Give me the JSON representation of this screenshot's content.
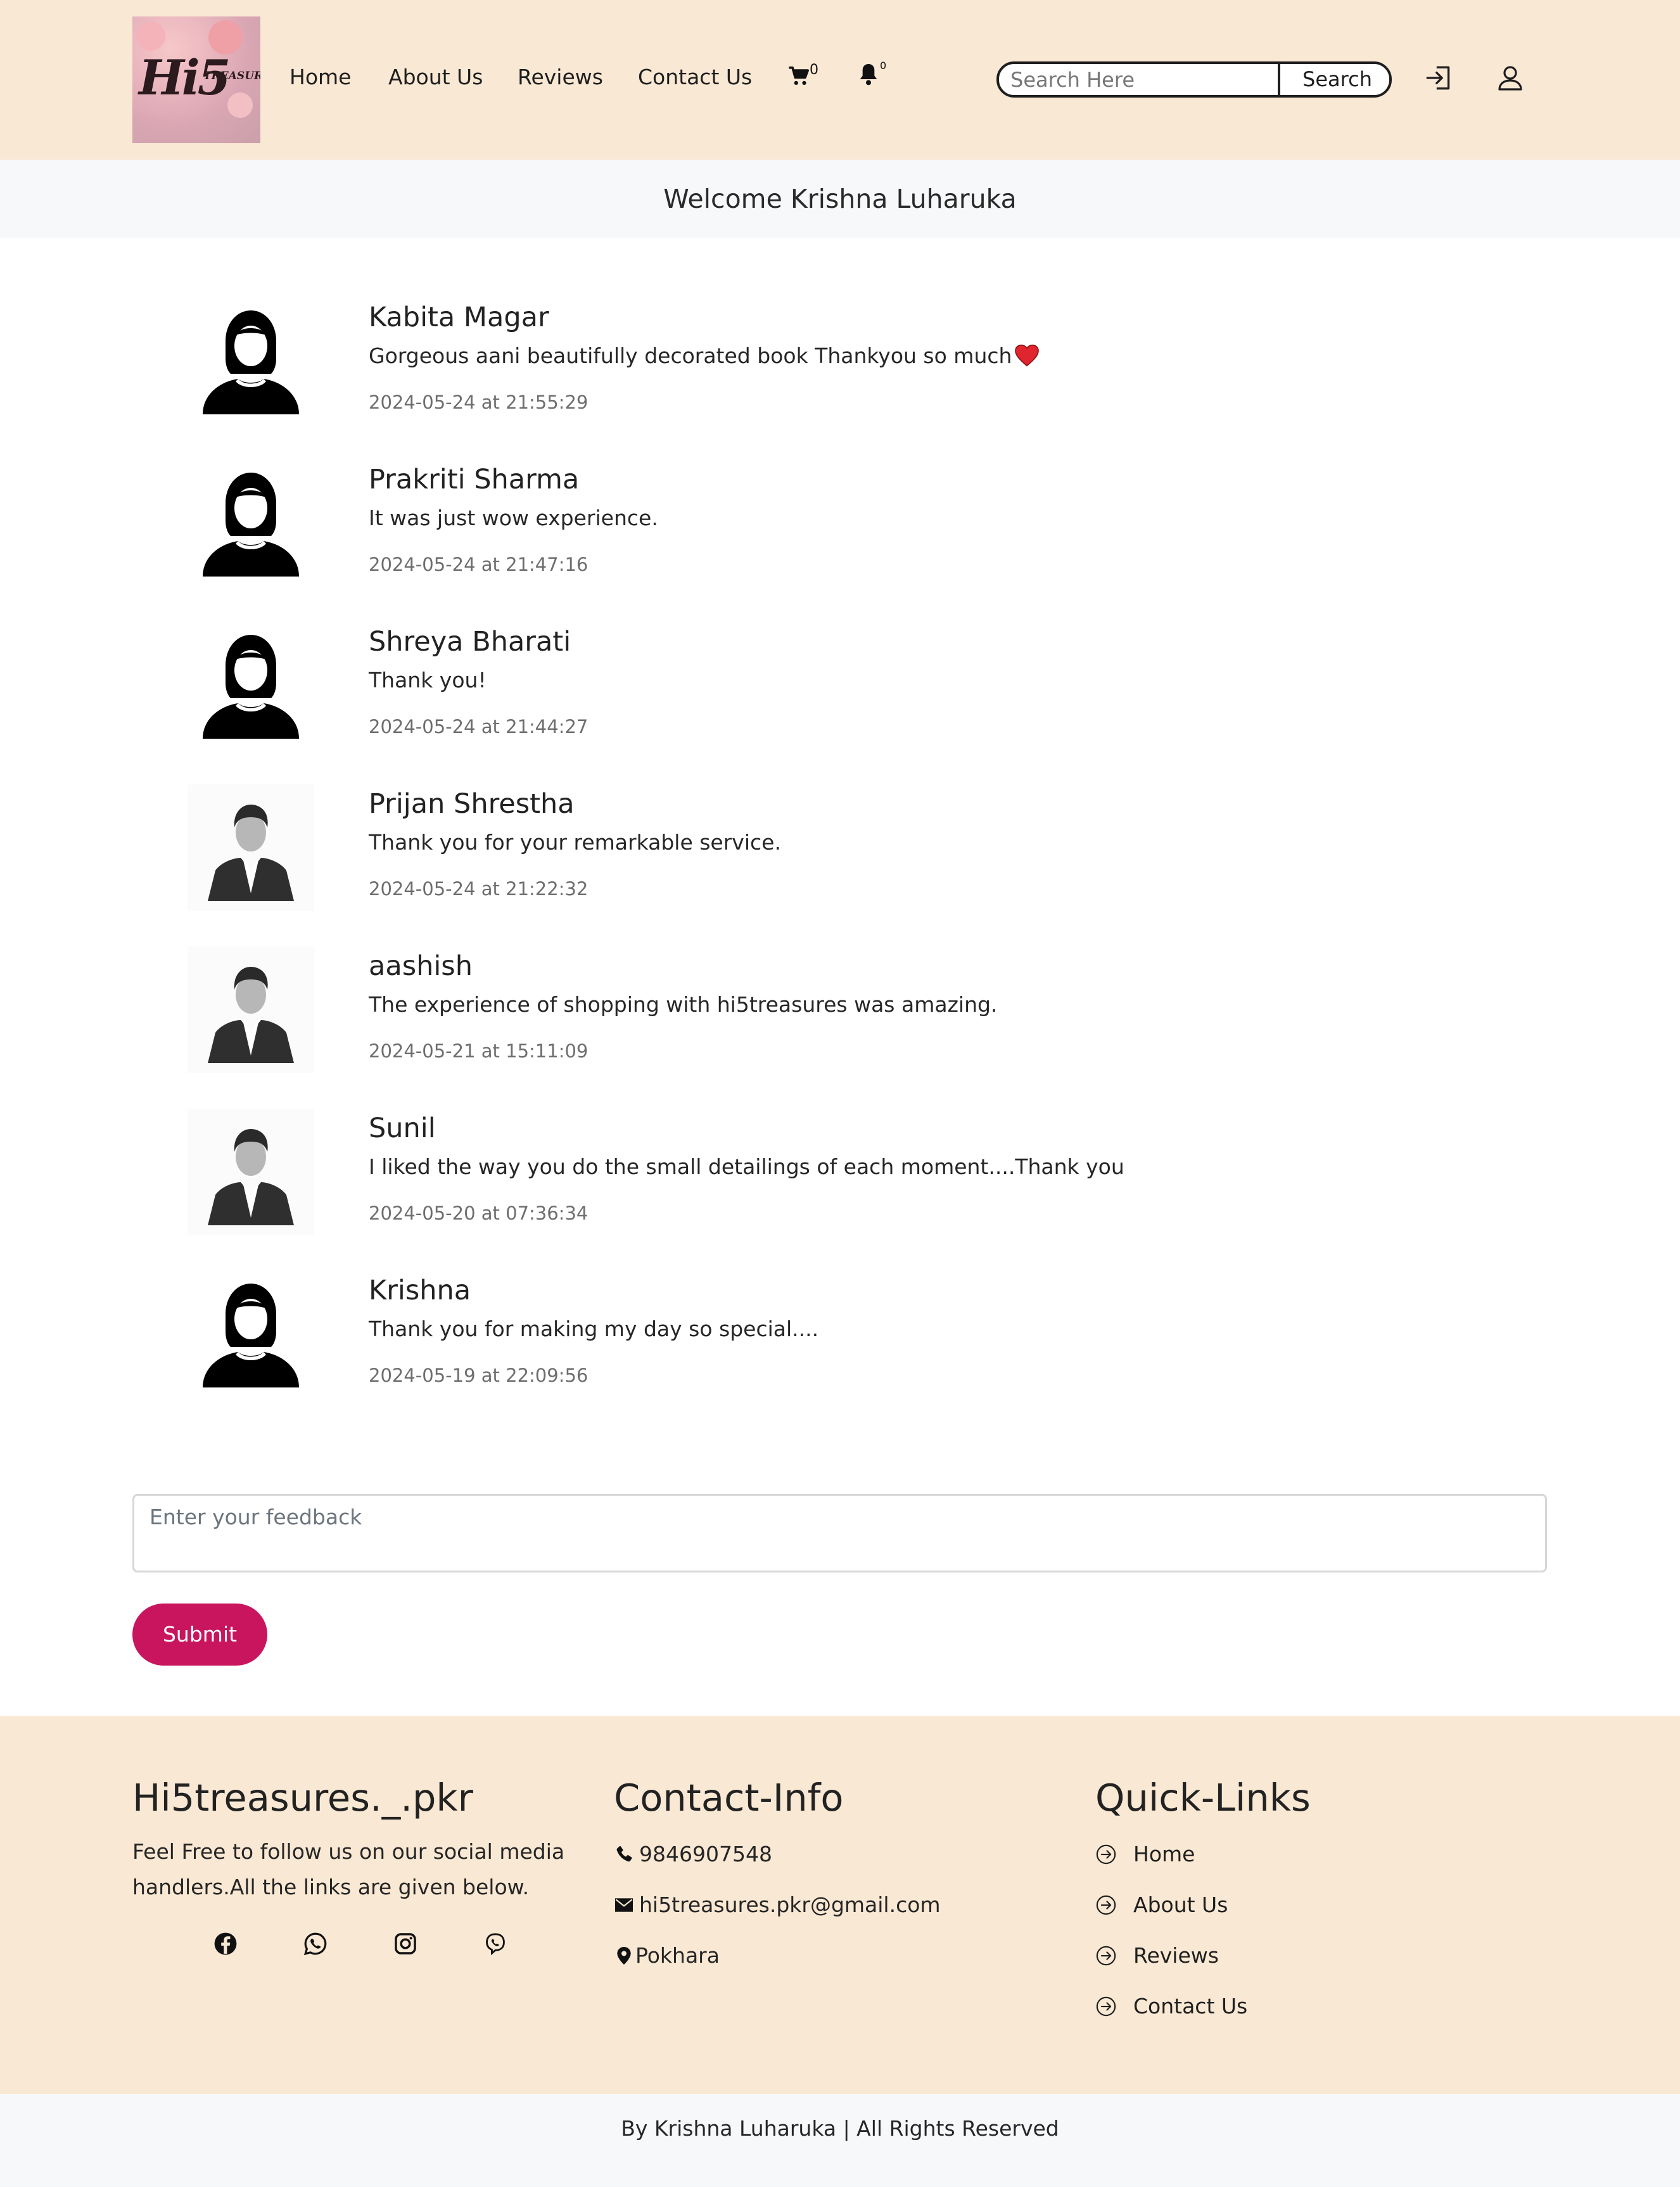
{
  "logo": {
    "main": "Hi5",
    "sub": "TREASURES"
  },
  "nav": {
    "links": [
      "Home",
      "About Us",
      "Reviews",
      "Contact Us"
    ],
    "cart_count": "0",
    "notif_count": "0",
    "search_placeholder": "Search Here",
    "search_button": "Search",
    "icons": [
      "cart-icon",
      "bell-icon",
      "login-icon",
      "user-icon"
    ]
  },
  "welcome": "Welcome Krishna Luharuka",
  "reviews": [
    {
      "name": "Kabita Magar",
      "text": "Gorgeous aani beautifully decorated book Thankyou so much",
      "date": "2024-05-24 at 21:55:29",
      "avatar": "female"
    },
    {
      "name": "Prakriti Sharma",
      "text": "It was just wow experience.",
      "date": "2024-05-24 at 21:47:16",
      "avatar": "female"
    },
    {
      "name": "Shreya Bharati",
      "text": "Thank you!",
      "date": "2024-05-24 at 21:44:27",
      "avatar": "female"
    },
    {
      "name": "Prijan Shrestha",
      "text": "Thank you for your remarkable service.",
      "date": "2024-05-24 at 21:22:32",
      "avatar": "male"
    },
    {
      "name": "aashish",
      "text": "The experience of shopping with hi5treasures was amazing.",
      "date": "2024-05-21 at 15:11:09",
      "avatar": "male"
    },
    {
      "name": "Sunil",
      "text": "I liked the way you do the small detailings of each moment....Thank you",
      "date": "2024-05-20 at 07:36:34",
      "avatar": "male"
    },
    {
      "name": "Krishna",
      "text": "Thank you for making my day so special....",
      "date": "2024-05-19 at 22:09:56",
      "avatar": "female"
    }
  ],
  "feedback": {
    "placeholder": "Enter your feedback",
    "submit_label": "Submit"
  },
  "footer": {
    "brand_title": "Hi5treasures._.pkr",
    "brand_desc": "Feel Free to follow us on our social media handlers.All the links are given below.",
    "social_icons": [
      "facebook-icon",
      "whatsapp-icon",
      "instagram-icon",
      "viber-icon"
    ],
    "contact_title": "Contact-Info",
    "phone": "9846907548",
    "email": "hi5treasures.pkr@gmail.com",
    "location": "Pokhara",
    "quick_title": "Quick-Links",
    "quick_links": [
      "Home",
      "About Us",
      "Reviews",
      "Contact Us"
    ]
  },
  "copyright": "By Krishna Luharuka | All Rights Reserved",
  "colors": {
    "header_bg": "#f9e8d3",
    "submit_bg": "#c8155e",
    "welcome_bg": "#f7f8fa"
  }
}
